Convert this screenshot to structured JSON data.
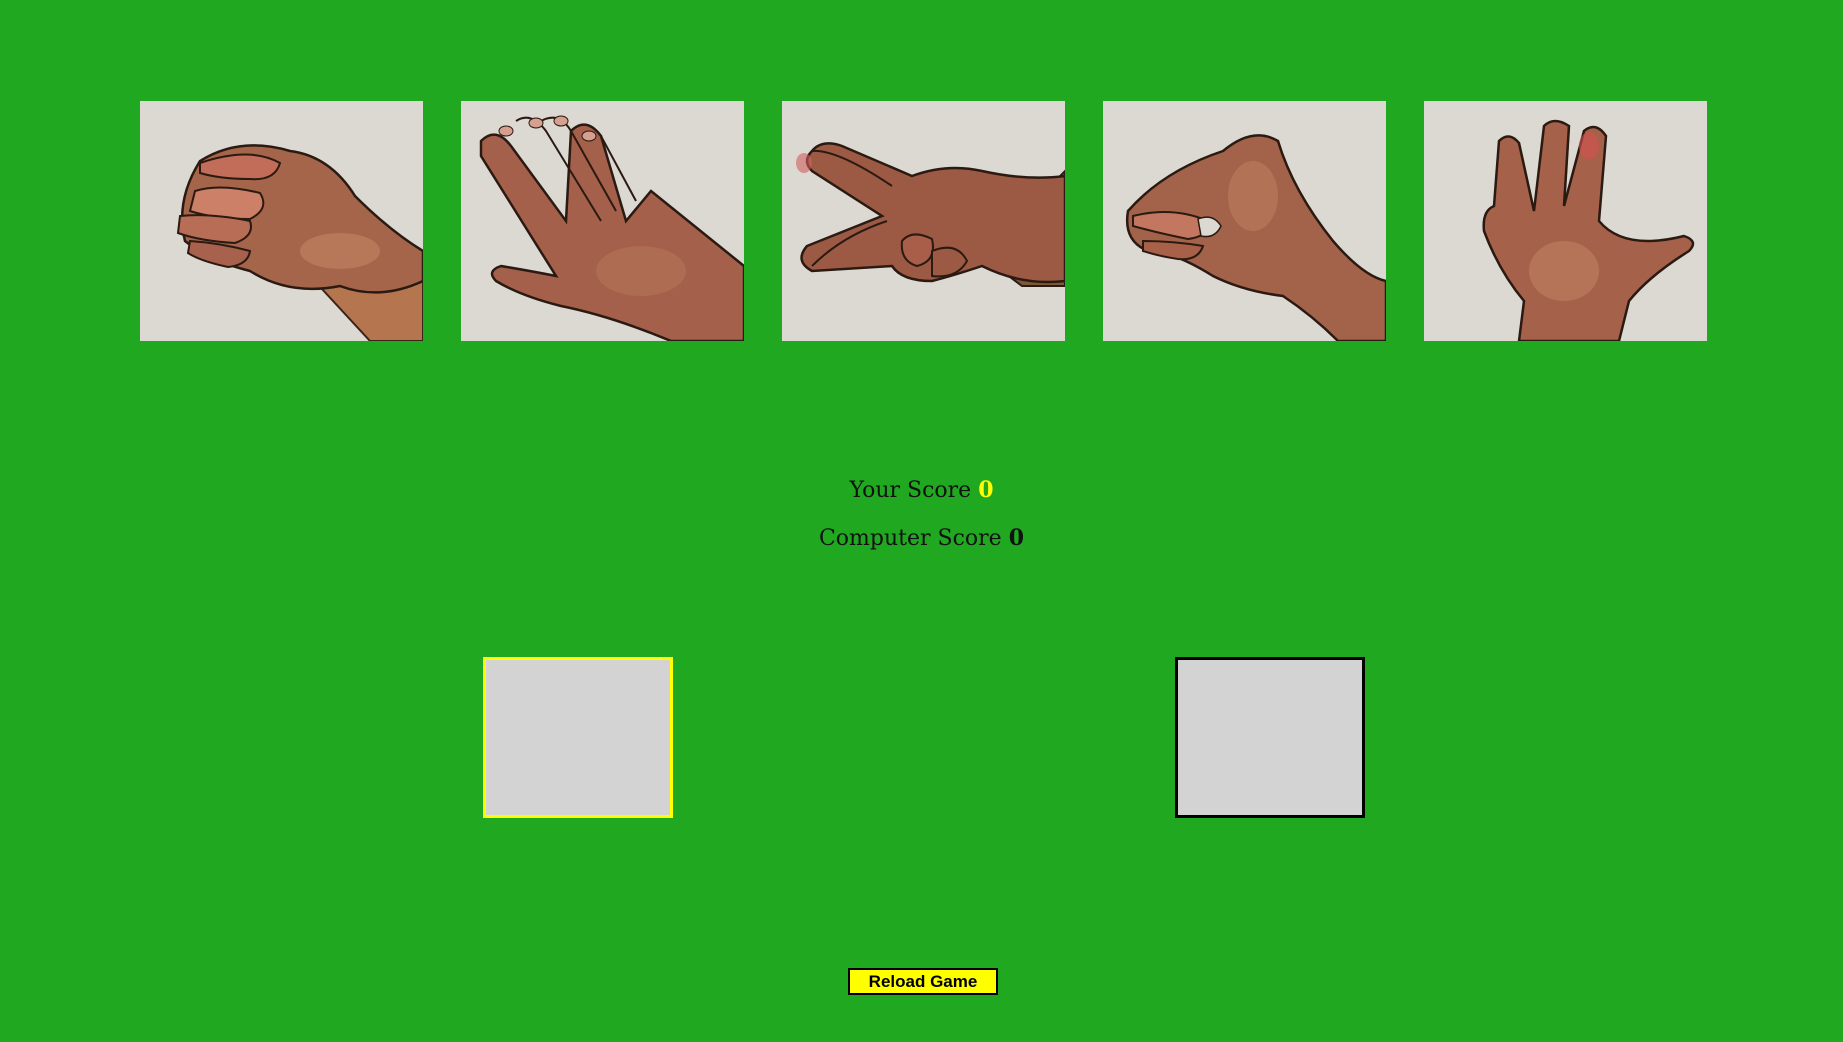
{
  "choices": [
    {
      "name": "rock"
    },
    {
      "name": "paper"
    },
    {
      "name": "scissors"
    },
    {
      "name": "lizard"
    },
    {
      "name": "spock"
    }
  ],
  "scores": {
    "user_label": "Your Score",
    "user_value": "0",
    "computer_label": "Computer Score",
    "computer_value": "0"
  },
  "reload_button": {
    "label": "Reload Game"
  },
  "colors": {
    "background": "#21a821",
    "user_accent": "#ffff00",
    "computer_border": "#000000",
    "empty_box": "#d3d3d3",
    "button_bg": "#ffff00"
  }
}
